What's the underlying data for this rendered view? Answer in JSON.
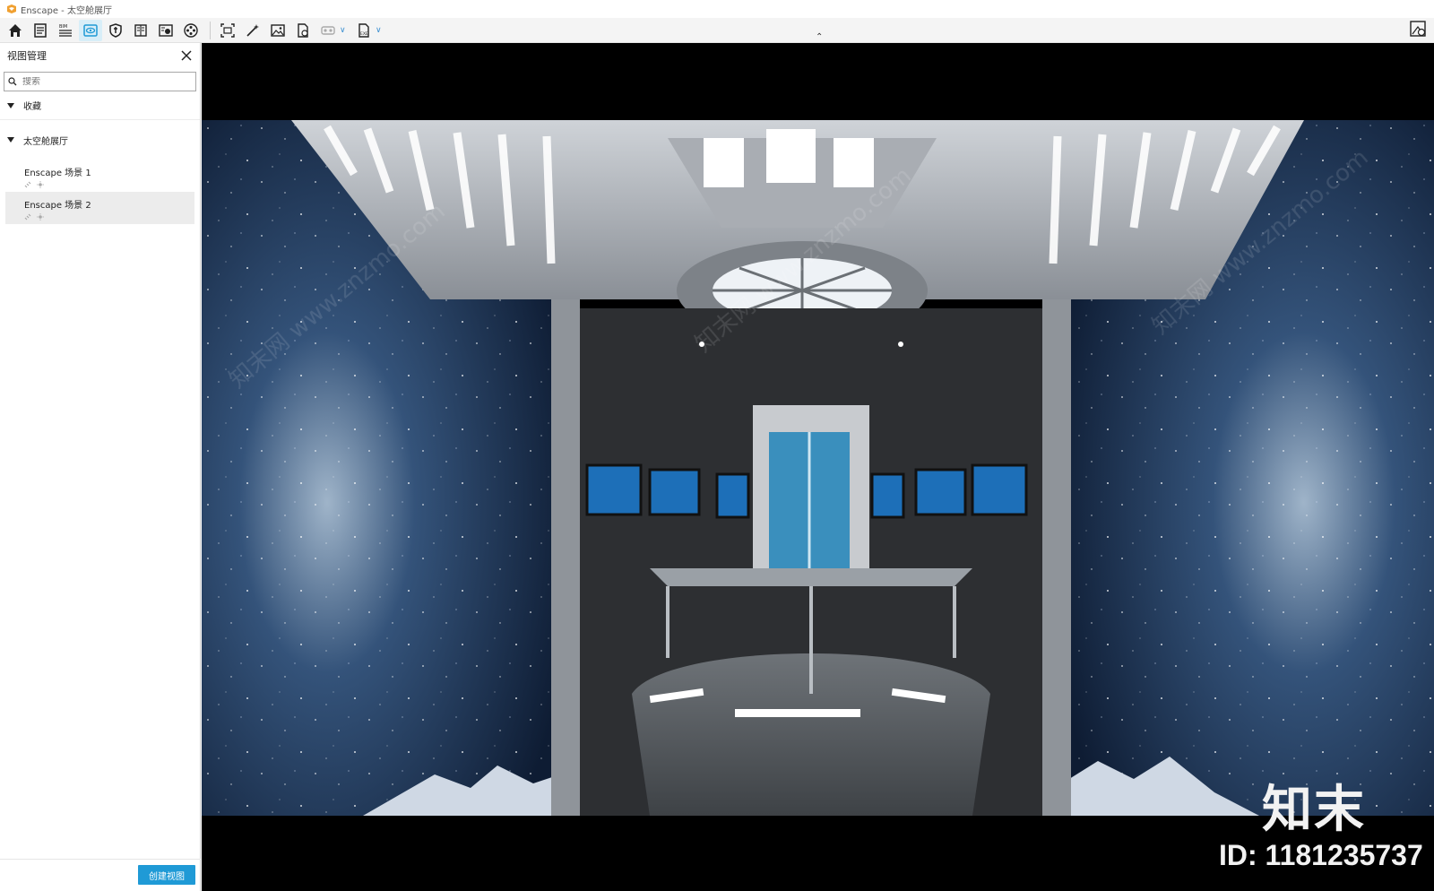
{
  "window": {
    "title": "Enscape - 太空舱展厅"
  },
  "toolbar": {
    "buttons": [
      {
        "icon": "home-icon"
      },
      {
        "icon": "document-icon"
      },
      {
        "icon": "bim-icon"
      },
      {
        "icon": "eye-view-icon",
        "active": true
      },
      {
        "icon": "shield-icon"
      },
      {
        "icon": "book-icon"
      },
      {
        "icon": "asset-icon"
      },
      {
        "icon": "film-icon"
      },
      {
        "icon": "screenshot-icon"
      },
      {
        "icon": "magic-wand-icon"
      },
      {
        "icon": "image-icon"
      },
      {
        "icon": "file-export-icon"
      },
      {
        "icon": "vr-headset-icon"
      },
      {
        "icon": "exe-export-icon"
      }
    ],
    "right_icon": "visual-settings-icon"
  },
  "sidebar": {
    "title": "视图管理",
    "search_placeholder": "搜索",
    "favorites_label": "收藏",
    "group_label": "太空舱展厅",
    "views": [
      {
        "label": "Enscape 场景 1",
        "selected": false
      },
      {
        "label": "Enscape 场景 2",
        "selected": true
      }
    ],
    "create_button": "创建视图"
  },
  "viewport": {
    "watermark_brand": "知末",
    "watermark_id": "ID: 1181235737",
    "overlay_text": "知末网 www.znzmo.com"
  },
  "colors": {
    "accent": "#1f9ad6",
    "toolbar_active": "#d8eef8",
    "sky": "#1b2f4e"
  }
}
